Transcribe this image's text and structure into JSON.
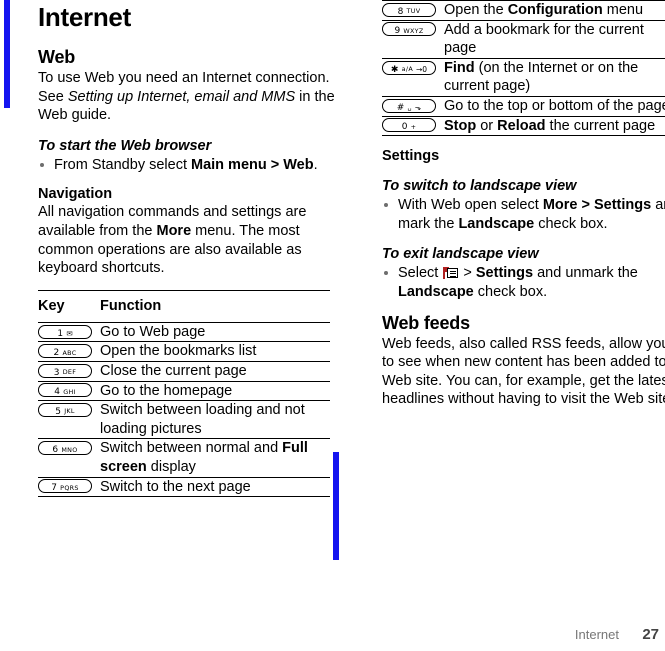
{
  "footer": {
    "section_name": "Internet",
    "page_number": "27"
  },
  "colors": {
    "rule_blue": "#1414f0",
    "footer_gray": "#777777",
    "icon_red": "#b02020"
  },
  "left_column": {
    "chapter_title": "Internet",
    "section_title": "Web",
    "intro_parts": {
      "p1": "To use Web you need an Internet connection. See ",
      "p2_italic": "Setting up Internet, email and MMS",
      "p3": " in the Web guide."
    },
    "task_start_browser": {
      "heading": "To start the Web browser",
      "step_parts": {
        "a": "From Standby select ",
        "b_bold": "Main menu > Web",
        "c": "."
      }
    },
    "navigation": {
      "heading": "Navigation",
      "body_parts": {
        "a": "All navigation commands and settings are available from the ",
        "b_bold": "More",
        "c": " menu. The most common operations are also available as keyboard shortcuts."
      }
    },
    "table_headers": {
      "key": "Key",
      "function": "Function"
    },
    "key_rows": [
      {
        "num": "1",
        "sub": "",
        "glyph": "✉",
        "fn_parts": {
          "a": "Go to Web page"
        }
      },
      {
        "num": "2",
        "sub": "ABC",
        "glyph": "",
        "fn_parts": {
          "a": "Open the bookmarks list"
        }
      },
      {
        "num": "3",
        "sub": "DEF",
        "glyph": "",
        "fn_parts": {
          "a": "Close the current page"
        }
      },
      {
        "num": "4",
        "sub": "GHI",
        "glyph": "",
        "fn_parts": {
          "a": "Go to the homepage"
        }
      },
      {
        "num": "5",
        "sub": "JKL",
        "glyph": "",
        "fn_parts": {
          "a": "Switch between loading and not loading pictures"
        }
      },
      {
        "num": "6",
        "sub": "MNO",
        "glyph": "",
        "fn_parts": {
          "a": "Switch between normal and ",
          "b_bold": "Full screen",
          "c": " display"
        }
      },
      {
        "num": "7",
        "sub": "PQRS",
        "glyph": "",
        "fn_parts": {
          "a": "Switch to the next page"
        }
      }
    ]
  },
  "right_column": {
    "key_rows": [
      {
        "num": "8",
        "sub": "TUV",
        "glyph": "",
        "fn_parts": {
          "a": "Open the ",
          "b_bold": "Configuration",
          "c": " menu"
        }
      },
      {
        "num": "9",
        "sub": "WXYZ",
        "glyph": "",
        "fn_parts": {
          "a": "Add a bookmark for the current page"
        }
      },
      {
        "num": "✱",
        "sub": "a/A",
        "glyph": "→0",
        "fn_parts": {
          "b_bold": "Find",
          "c": " (on the Internet or on the current page)"
        }
      },
      {
        "num": "#",
        "sub": "␣",
        "glyph": "⬎",
        "fn_parts": {
          "a": "Go to the top or bottom of the page"
        }
      },
      {
        "num": "0",
        "sub": "+",
        "glyph": "",
        "fn_parts": {
          "b_bold": "Stop",
          "c": " or ",
          "d_bold": "Reload",
          "e": " the current page"
        }
      }
    ],
    "settings": {
      "heading": "Settings",
      "task_switch": {
        "heading": "To switch to landscape view",
        "step_parts": {
          "a": "With Web open select ",
          "b_bold": "More > Settings",
          "c": " and mark the ",
          "d_bold": "Landscape",
          "e": " check box."
        }
      },
      "task_exit": {
        "heading": "To exit landscape view",
        "step_parts": {
          "a": "Select ",
          "icon": "menu-icon",
          "b": " > ",
          "c_bold": "Settings",
          "d": " and unmark the ",
          "e_bold": "Landscape",
          "f": " check box."
        }
      }
    },
    "web_feeds": {
      "heading": "Web feeds",
      "body": "Web feeds, also called RSS feeds, allow you to see when new content has been added to a Web site. You can, for example, get the latest headlines without having to visit the Web site."
    }
  }
}
